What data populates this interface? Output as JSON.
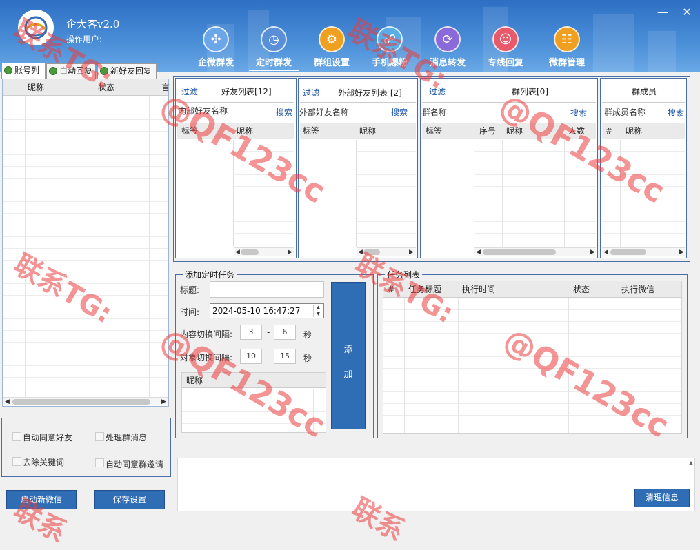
{
  "app": {
    "title": "企大客v2.0",
    "operator_label": "操作用户:"
  },
  "nav": [
    {
      "label": "企微群发",
      "icon": "share-nodes-icon",
      "color": "#6aa6e8"
    },
    {
      "label": "定时群发",
      "icon": "clock-grid-icon",
      "color": "#5a8fd8"
    },
    {
      "label": "群组设置",
      "icon": "group-settings-icon",
      "color": "#f0a020"
    },
    {
      "label": "手机爆粉",
      "icon": "mobile-network-icon",
      "color": "#5aaee8"
    },
    {
      "label": "消息转发",
      "icon": "forward-cycle-icon",
      "color": "#8a6ad8"
    },
    {
      "label": "专线回复",
      "icon": "users-reply-icon",
      "color": "#e85a6a"
    },
    {
      "label": "微群管理",
      "icon": "group-manage-icon",
      "color": "#f0a020"
    }
  ],
  "left_tabs": [
    "账号列",
    "自动回复",
    "新好友回复"
  ],
  "account_grid": {
    "columns": [
      "昵称",
      "状态",
      "言"
    ]
  },
  "options": {
    "auto_accept_friend": "自动同意好友",
    "handle_group_msg": "处理群消息",
    "remove_keywords": "去除关键词",
    "auto_accept_group_invite": "自动同意群邀请"
  },
  "bottom_buttons": {
    "start_wechat": "启动新微信",
    "save_settings": "保存设置",
    "clear_info": "清理信息"
  },
  "friends_panel": {
    "filter": "过滤",
    "title": "好友列表[12]",
    "search_label": "内部好友名称",
    "search": "搜索",
    "columns": [
      "标签",
      "昵称"
    ]
  },
  "external_panel": {
    "filter": "过滤",
    "title": "外部好友列表 [2]",
    "search_label": "外部好友名称",
    "search": "搜索",
    "columns": [
      "标签",
      "昵称"
    ]
  },
  "groups_panel": {
    "filter": "过滤",
    "title": "群列表[0]",
    "search_label": "群名称",
    "search": "搜索",
    "columns": [
      "标签",
      "序号",
      "昵称",
      "人数"
    ]
  },
  "members_panel": {
    "title": "群成员",
    "search_label": "群成员名称",
    "search": "搜索",
    "columns": [
      "#",
      "昵称"
    ]
  },
  "add_task": {
    "legend": "添加定时任务",
    "title_label": "标题:",
    "title_value": "",
    "time_label": "时间:",
    "time_value": "2024-05-10 16:47:27",
    "content_interval_label": "内容切换间隔:",
    "content_min": "3",
    "content_max": "6",
    "target_interval_label": "对象切换间隔:",
    "target_min": "10",
    "target_max": "15",
    "dash": "-",
    "unit": "秒",
    "list_column": "昵称",
    "add_button_line1": "添",
    "add_button_line2": "加"
  },
  "task_list": {
    "legend": "任务列表",
    "columns": [
      "#",
      "任务标题",
      "执行时间",
      "状态",
      "执行微信"
    ]
  },
  "watermark": {
    "line1": "联系TG:",
    "line2": "@QF123cc",
    "short": "联系"
  }
}
